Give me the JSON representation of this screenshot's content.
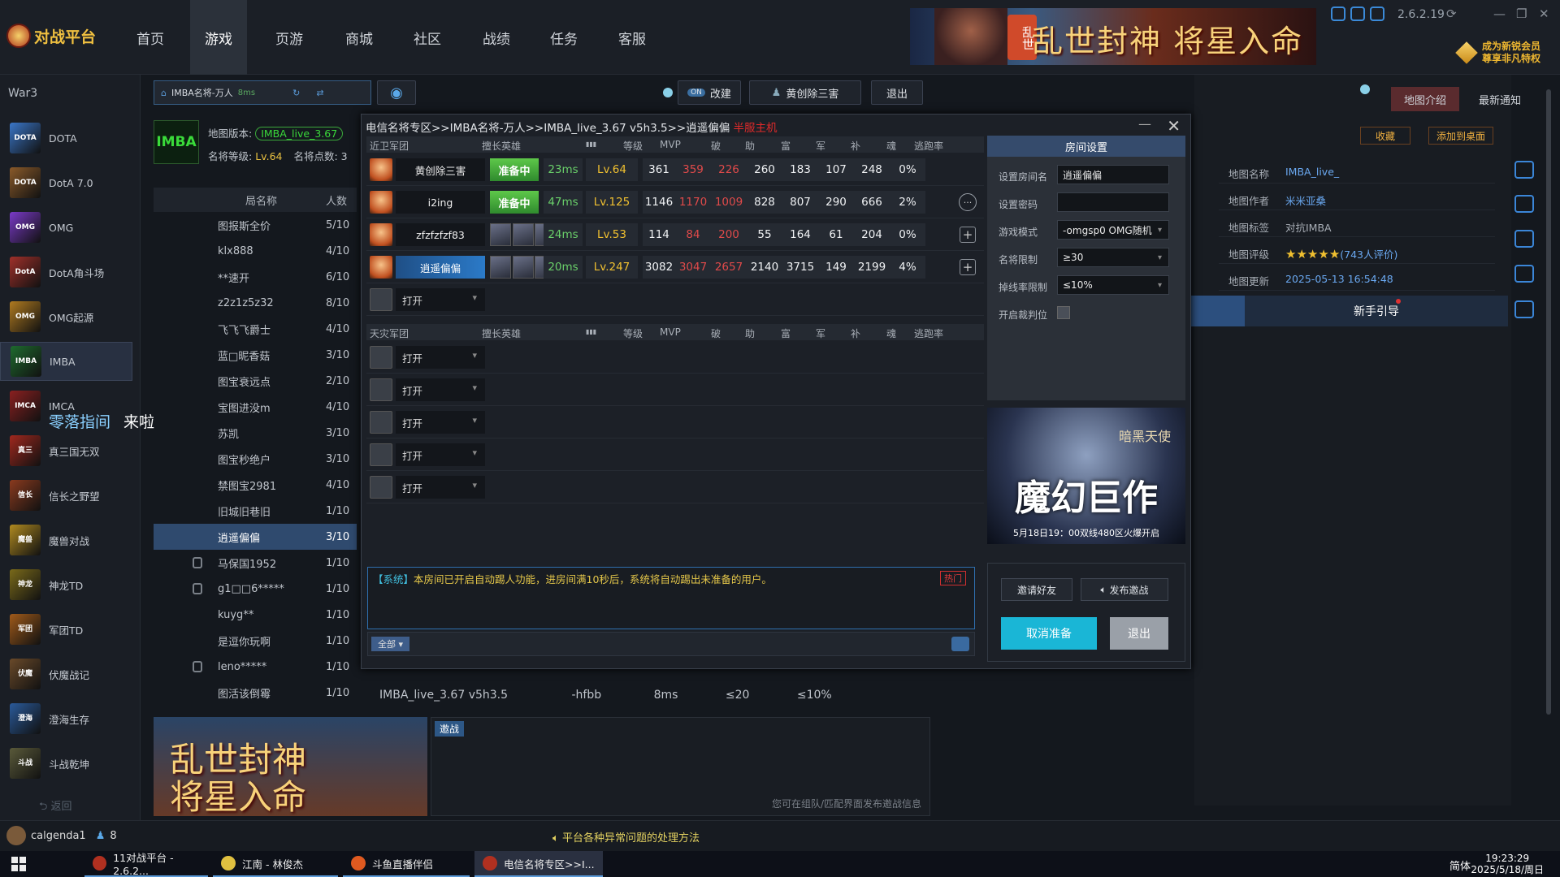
{
  "app": {
    "logo_text": "对战平台",
    "version": "2.6.2.19"
  },
  "nav": [
    {
      "label": "首页"
    },
    {
      "label": "游戏",
      "active": true
    },
    {
      "label": "页游"
    },
    {
      "label": "商城"
    },
    {
      "label": "社区"
    },
    {
      "label": "战绩"
    },
    {
      "label": "任务"
    },
    {
      "label": "客服"
    }
  ],
  "top_banner": {
    "tag": "乱世",
    "title": "乱世封神 将星入命"
  },
  "vip": {
    "line1": "成为新锐会员",
    "line2": "尊享非凡特权"
  },
  "sidebar": {
    "header": "War3",
    "items": [
      {
        "label": "DOTA",
        "icon": "DOTA",
        "color": "#3a76c8"
      },
      {
        "label": "DotA 7.0",
        "icon": "DOTA",
        "color": "#8a5a2a"
      },
      {
        "label": "OMG",
        "icon": "OMG",
        "color": "#7a3ac8"
      },
      {
        "label": "DotA角斗场",
        "icon": "DotA",
        "color": "#a0302a"
      },
      {
        "label": "OMG起源",
        "icon": "OMG",
        "color": "#b07a20"
      },
      {
        "label": "IMBA",
        "icon": "IMBA",
        "color": "#1e6a2e",
        "selected": true
      },
      {
        "label": "IMCA",
        "icon": "IMCA",
        "color": "#8a2020"
      },
      {
        "label": "真三国无双",
        "icon": "真三",
        "color": "#a0281e"
      },
      {
        "label": "信长之野望",
        "icon": "信长",
        "color": "#8a3a1e"
      },
      {
        "label": "魔兽对战",
        "icon": "魔兽",
        "color": "#b08a20"
      },
      {
        "label": "神龙TD",
        "icon": "神龙",
        "color": "#7a6a1a"
      },
      {
        "label": "军团TD",
        "icon": "军团",
        "color": "#a05a1a"
      },
      {
        "label": "伏魔战记",
        "icon": "伏魔",
        "color": "#6a4a2a"
      },
      {
        "label": "澄海生存",
        "icon": "澄海",
        "color": "#2a5a9a"
      },
      {
        "label": "斗战乾坤",
        "icon": "斗战",
        "color": "#5a5a3a"
      }
    ],
    "back": "返回"
  },
  "lobby": {
    "room_name": "IMBA名将-万人",
    "room_ms": "8ms",
    "map_version_label": "地图版本:",
    "map_version": "IMBA_live_3.67",
    "level_label": "名将等级:",
    "level": "Lv.64",
    "points_label": "名将点数:",
    "points": "3",
    "list_headers": {
      "name": "局名称",
      "count": "人数"
    },
    "rooms": [
      {
        "name": "图报斯全价",
        "count": "5/10"
      },
      {
        "name": "klx888",
        "count": "4/10"
      },
      {
        "name": "**速开",
        "count": "6/10"
      },
      {
        "name": "z2z1z5z32",
        "count": "8/10"
      },
      {
        "name": "飞飞飞爵士",
        "count": "4/10"
      },
      {
        "name": "蓝□昵香菇",
        "count": "3/10"
      },
      {
        "name": "图宝衰远点",
        "count": "2/10"
      },
      {
        "name": "宝图进没m",
        "count": "4/10"
      },
      {
        "name": "苏凯",
        "count": "3/10"
      },
      {
        "name": "图宝秒绝户",
        "count": "3/10"
      },
      {
        "name": "禁图宝2981",
        "count": "4/10"
      },
      {
        "name": "旧城旧巷旧",
        "count": "1/10"
      },
      {
        "name": "逍遥偏偏",
        "count": "3/10",
        "selected": true
      },
      {
        "name": "马保国1952",
        "count": "1/10",
        "locked": true
      },
      {
        "name": "g1□□6*****",
        "count": "1/10",
        "locked": true
      },
      {
        "name": "kuyg**",
        "count": "1/10"
      },
      {
        "name": "是逗你玩啊",
        "count": "1/10"
      },
      {
        "name": "leno*****",
        "count": "1/10",
        "locked": true
      },
      {
        "name": "图活该倒霉",
        "count": "1/10"
      }
    ],
    "last_row": {
      "map": "IMBA_live_3.67 v5h3.5",
      "mode": "-hfbb",
      "ping": "8ms",
      "level": "≤20",
      "escape": "≤10%"
    }
  },
  "controls": {
    "on": "ON",
    "rebuild": "改建",
    "player": "黄创除三害",
    "exit": "退出"
  },
  "floating_text": {
    "a": "零落指间",
    "b": "来啦"
  },
  "dialog": {
    "breadcrumb": "电信名将专区>>IMBA名将-万人>>IMBA_live_3.67 v5h3.5>>逍遥偏偏",
    "host_tag": "半服主机",
    "team1": "近卫军团",
    "team2": "天灾军团",
    "columns": {
      "hero": "擅长英雄",
      "level": "等级",
      "mvp": "MVP",
      "po": "破",
      "zhu": "助",
      "fu": "富",
      "jun": "军",
      "bu": "补",
      "hun": "魂",
      "escape": "逃跑率"
    },
    "players": [
      {
        "name": "黄创除三害",
        "status": "准备中",
        "ping": "23ms",
        "level": "Lv.64",
        "mvp": "361",
        "po": "359",
        "zhu": "226",
        "fu": "260",
        "jun": "183",
        "bu": "107",
        "hun": "248",
        "escape": "0%",
        "action": "none"
      },
      {
        "name": "i2ing",
        "status": "准备中",
        "ping": "47ms",
        "level": "Lv.125",
        "mvp": "1146",
        "po": "1170",
        "zhu": "1009",
        "fu": "828",
        "jun": "807",
        "bu": "290",
        "hun": "666",
        "escape": "2%",
        "action": "chat"
      },
      {
        "name": "zfzfzfzf83",
        "status": "",
        "ping": "24ms",
        "level": "Lv.53",
        "mvp": "114",
        "po": "84",
        "zhu": "200",
        "fu": "55",
        "jun": "164",
        "bu": "61",
        "hun": "204",
        "escape": "0%",
        "action": "plus"
      },
      {
        "name": "逍遥偏偏",
        "status": "",
        "ping": "20ms",
        "level": "Lv.247",
        "mvp": "3082",
        "po": "3047",
        "zhu": "2657",
        "fu": "2140",
        "jun": "3715",
        "bu": "149",
        "hun": "2199",
        "escape": "4%",
        "action": "plus",
        "host": true
      }
    ],
    "open_label": "打开",
    "system_prefix": "【系统】",
    "system_msg": "本房间已开启自动踢人功能，进房间满10秒后，系统将自动踢出未准备的用户。",
    "hot": "热门",
    "chat_scope": "全部",
    "settings": {
      "title": "房间设置",
      "room_name_label": "设置房间名",
      "room_name": "逍遥偏偏",
      "password_label": "设置密码",
      "password": "",
      "mode_label": "游戏模式",
      "mode": "-omgsp0 OMG随机",
      "level_label": "名将限制",
      "level": "≥30",
      "escape_label": "掉线率限制",
      "escape": "≤10%",
      "judge_label": "开启裁判位"
    },
    "banner": {
      "title": "魔幻巨作",
      "tag": "暗黑天使",
      "date": "5月18日19：00双线480区火爆开启"
    },
    "invite": "邀请好友",
    "publish": "发布邀战",
    "cancel_ready": "取消准备",
    "exit": "退出"
  },
  "right_panel": {
    "tab_map": "地图介绍",
    "tab_news": "最新通知",
    "collect": "收藏",
    "add_desktop": "添加到桌面",
    "info": [
      {
        "key": "地图名称",
        "value": "IMBA_live_"
      },
      {
        "key": "地图作者",
        "value": "米米亚桑"
      },
      {
        "key": "地图标签",
        "value": "对抗IMBA"
      },
      {
        "key": "地图评级",
        "value": "(743人评价)"
      },
      {
        "key": "地图更新",
        "value": "2025-05-13 16:54:48"
      }
    ],
    "guide": "新手引导",
    "stars": 5
  },
  "bottom_lobby": {
    "tab": "邀战",
    "hint": "您可在组队/匹配界面发布邀战信息",
    "ad": "乱世封神\n将星入命"
  },
  "status_bar": {
    "user": "calgenda1",
    "friends": "8",
    "notice": "平台各种异常问题的处理方法"
  },
  "taskbar": {
    "tasks": [
      "11对战平台 - 2.6.2...",
      "江南 - 林俊杰",
      "斗鱼直播伴侣",
      "电信名将专区>>I..."
    ],
    "ime": "简体",
    "time": "19:23:29",
    "date": "2025/5/18/周日"
  }
}
